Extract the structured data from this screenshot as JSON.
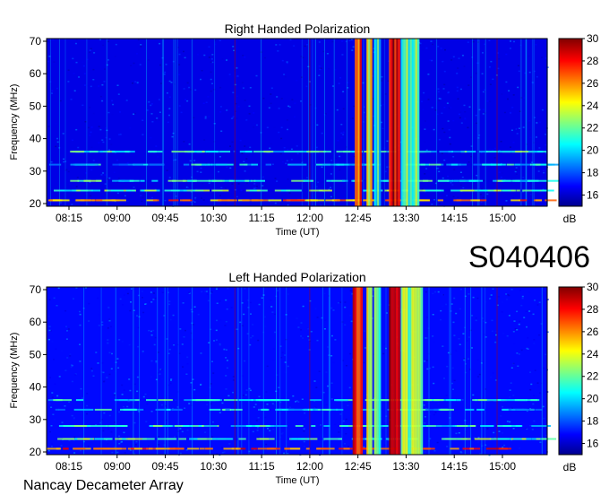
{
  "code": "S040406",
  "credit": "Nancay Decameter Array",
  "chart_data": [
    {
      "type": "heatmap",
      "title": "Right Handed Polarization",
      "xlabel": "Time (UT)",
      "ylabel": "Frequency (MHz)",
      "x_ticks": [
        "08:15",
        "09:00",
        "09:45",
        "10:30",
        "11:15",
        "12:00",
        "12:45",
        "13:30",
        "14:15",
        "15:00"
      ],
      "y_ticks": [
        "20",
        "30",
        "40",
        "50",
        "60",
        "70"
      ],
      "ylim": [
        20,
        70
      ],
      "colorbar": {
        "label": "dB",
        "ticks": [
          "16",
          "18",
          "20",
          "22",
          "24",
          "26",
          "28",
          "30"
        ],
        "range": [
          15,
          30
        ]
      },
      "grid": false,
      "background_level_db": 16.5,
      "features": [
        {
          "kind": "burst",
          "start": "12:42",
          "end": "12:48",
          "level_db": 28
        },
        {
          "kind": "burst",
          "start": "12:53",
          "end": "12:58",
          "level_db": 25
        },
        {
          "kind": "burst",
          "start": "13:00",
          "end": "13:06",
          "level_db": 22
        },
        {
          "kind": "burst",
          "start": "13:14",
          "end": "13:24",
          "level_db": 30
        },
        {
          "kind": "burst",
          "start": "13:25",
          "end": "13:42",
          "level_db": 23
        },
        {
          "kind": "interference_band",
          "freq_mhz": 21,
          "level_db": 26
        },
        {
          "kind": "interference_band",
          "freq_mhz": 24,
          "level_db": 22
        },
        {
          "kind": "interference_band",
          "freq_mhz": 27,
          "level_db": 21
        },
        {
          "kind": "interference_band",
          "freq_mhz": 32,
          "level_db": 20
        },
        {
          "kind": "interference_band",
          "freq_mhz": 36,
          "level_db": 21
        }
      ]
    },
    {
      "type": "heatmap",
      "title": "Left Handed Polarization",
      "xlabel": "Time (UT)",
      "ylabel": "Frequency (MHz)",
      "x_ticks": [
        "08:15",
        "09:00",
        "09:45",
        "10:30",
        "11:15",
        "12:00",
        "12:45",
        "13:30",
        "14:15",
        "15:00"
      ],
      "y_ticks": [
        "20",
        "30",
        "40",
        "50",
        "60",
        "70"
      ],
      "ylim": [
        20,
        70
      ],
      "colorbar": {
        "label": "dB",
        "ticks": [
          "16",
          "18",
          "20",
          "22",
          "24",
          "26",
          "28",
          "30"
        ],
        "range": [
          15,
          30
        ]
      },
      "grid": false,
      "background_level_db": 17,
      "features": [
        {
          "kind": "burst",
          "start": "12:40",
          "end": "12:49",
          "level_db": 29
        },
        {
          "kind": "burst",
          "start": "12:53",
          "end": "12:58",
          "level_db": 25
        },
        {
          "kind": "burst",
          "start": "13:00",
          "end": "13:06",
          "level_db": 23
        },
        {
          "kind": "burst",
          "start": "13:14",
          "end": "13:24",
          "level_db": 30
        },
        {
          "kind": "burst",
          "start": "13:25",
          "end": "13:45",
          "level_db": 24
        },
        {
          "kind": "interference_band",
          "freq_mhz": 21,
          "level_db": 27
        },
        {
          "kind": "interference_band",
          "freq_mhz": 24,
          "level_db": 22
        },
        {
          "kind": "interference_band",
          "freq_mhz": 28,
          "level_db": 21
        },
        {
          "kind": "interference_band",
          "freq_mhz": 33,
          "level_db": 20
        },
        {
          "kind": "interference_band",
          "freq_mhz": 36,
          "level_db": 21
        }
      ]
    }
  ]
}
